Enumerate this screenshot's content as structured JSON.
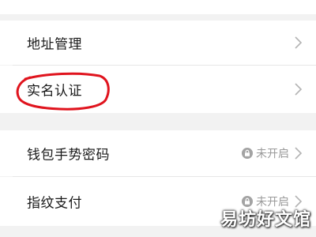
{
  "settings": {
    "rows": [
      {
        "label": "地址管理"
      },
      {
        "label": "实名认证"
      },
      {
        "label": "钱包手势密码",
        "status": "未开启"
      },
      {
        "label": "指纹支付",
        "status": "未开启"
      }
    ]
  },
  "icons": {
    "chevron": "chevron-right-icon",
    "lock": "lock-icon"
  },
  "colors": {
    "background": "#f2f2f2",
    "row": "#ffffff",
    "annotation": "#e0141e",
    "status_text": "#9a9a9a"
  },
  "watermark": "易坊好文馆"
}
